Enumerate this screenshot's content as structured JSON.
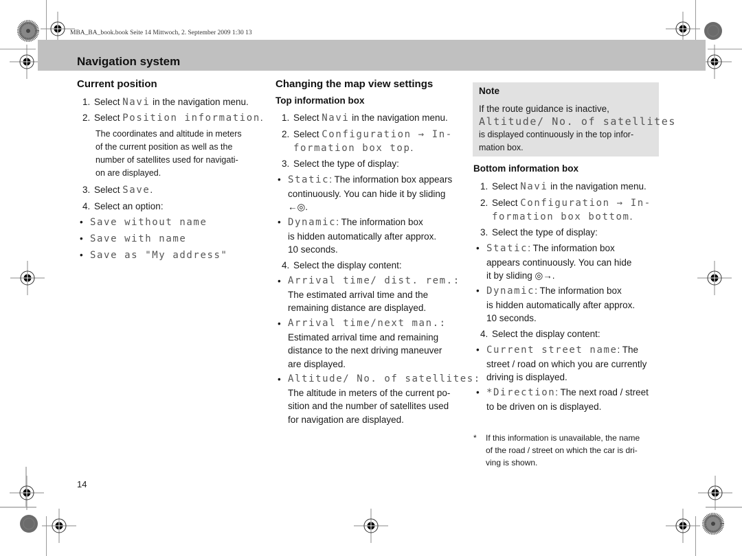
{
  "book_meta": "MBA_BA_book.book  Seite 14  Mittwoch, 2. September 2009  1:30 13",
  "header": {
    "title": "Navigation system"
  },
  "page_number": "14",
  "col1": {
    "heading": "Current position",
    "steps": [
      {
        "n": "1.",
        "pre": "Select ",
        "code": "Navi",
        "post": " in the navigation menu."
      },
      {
        "n": "2.",
        "pre": "Select ",
        "code": "Position information",
        "post": "."
      },
      {
        "n": "3.",
        "pre": "Select ",
        "code": "Save",
        "post": "."
      },
      {
        "n": "4.",
        "pre": "Select an option:",
        "code": "",
        "post": ""
      }
    ],
    "step2_desc": [
      "The coordinates and altitude in meters",
      "of the current position as well as the",
      "number of satellites used for navigati-",
      "on are displayed."
    ],
    "options": [
      "Save without name",
      "Save with name",
      "Save as \"My address\""
    ]
  },
  "col2": {
    "heading": "Changing the map view settings",
    "subheading": "Top information box",
    "step1": {
      "n": "1.",
      "pre": "Select ",
      "code": "Navi",
      "post": " in the navigation menu."
    },
    "step2": {
      "n": "2.",
      "pre": "Select ",
      "code1": "Configuration → In-",
      "code2": "formation box top",
      "post": "."
    },
    "step3": {
      "n": "3.",
      "text": "Select the type of display:"
    },
    "types": [
      {
        "code": "Static",
        "lines": [
          ": The information box appears",
          "continuously. You can hide it by sliding",
          "←◎."
        ]
      },
      {
        "code": "Dynamic",
        "lines": [
          ": The information box",
          "is hidden automatically after approx.",
          "10 seconds."
        ]
      }
    ],
    "step4": {
      "n": "4.",
      "text": "Select the display content:"
    },
    "contents": [
      {
        "code": "Arrival time/ dist. rem.:",
        "lines": [
          "The estimated arrival time and the",
          "remaining distance are displayed."
        ]
      },
      {
        "code": "Arrival time/next man.:",
        "lines": [
          "Estimated arrival time and remaining",
          "distance to the next driving maneuver",
          "are displayed."
        ]
      },
      {
        "code": "Altitude/ No. of satellites:",
        "lines": [
          "The altitude in meters of the current po-",
          "sition and the number of satellites used",
          "for navigation are displayed."
        ]
      }
    ]
  },
  "col3": {
    "note": {
      "title": "Note",
      "line1": "If the route guidance is inactive,",
      "code": "Altitude/ No. of satellites",
      "line3": "is displayed continuously in the top infor-",
      "line4": "mation box."
    },
    "subheading": "Bottom information box",
    "step1": {
      "n": "1.",
      "pre": "Select ",
      "code": "Navi",
      "post": " in the navigation menu."
    },
    "step2": {
      "n": "2.",
      "pre": "Select ",
      "code1": "Configuration → In-",
      "code2": "formation box bottom",
      "post": "."
    },
    "step3": {
      "n": "3.",
      "text": "Select the type of display:"
    },
    "types": [
      {
        "code": "Static",
        "lines": [
          ": The information box",
          "appears continuously. You can hide",
          "it by sliding ◎→."
        ]
      },
      {
        "code": "Dynamic",
        "lines": [
          ": The information box",
          "is hidden automatically after approx.",
          "10 seconds."
        ]
      }
    ],
    "step4": {
      "n": "4.",
      "text": "Select the display content:"
    },
    "contents": [
      {
        "code": "Current street name",
        "lines": [
          ": The",
          "street / road on which you are currently",
          "driving is displayed."
        ]
      },
      {
        "code": "*Direction",
        "lines": [
          ": The next road / street",
          "to be driven on is displayed."
        ]
      }
    ],
    "footnote": {
      "mark": "*",
      "lines": [
        "If this information is unavailable, the name",
        "of the road / street on which the car is dri-",
        "ving is shown."
      ]
    }
  }
}
